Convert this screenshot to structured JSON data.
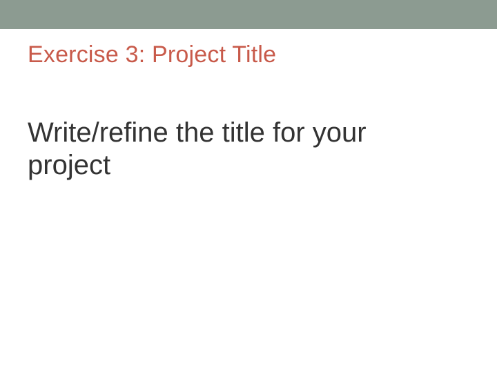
{
  "slide": {
    "heading": "Exercise 3: Project Title",
    "body": "Write/refine the title for your project"
  },
  "colors": {
    "top_bar": "#8c9b91",
    "heading": "#c85a4a",
    "body": "#333333"
  }
}
